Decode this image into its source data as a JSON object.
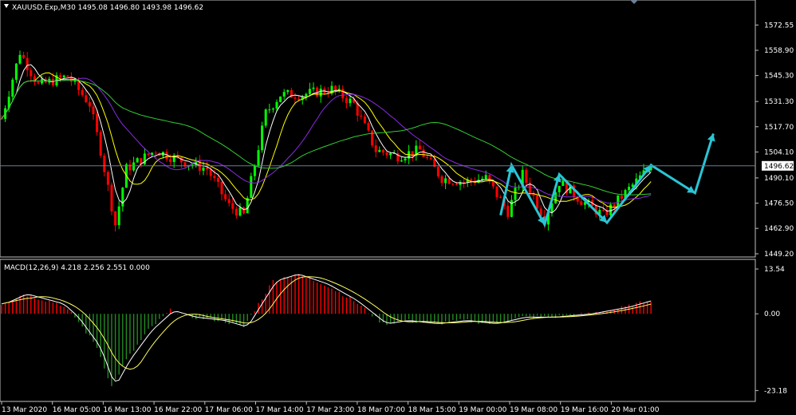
{
  "window": {
    "symbol_info": "XAUUSD.Exp,M30  1495.08 1496.80 1493.98 1496.62",
    "macd_info": "MACD(12,26,9) 4.218 2.256 2.551 0.000"
  },
  "colors": {
    "background": "#000000",
    "frame": "#c0c0c0",
    "bull": "#00ff00",
    "bear": "#ff0000",
    "ma_fast": "#ffffff",
    "ma_mid": "#ffff00",
    "ma_slow": "#8a2be2",
    "ma_long": "#32cd32",
    "annotation": "#29c5d6",
    "macd_up": "#ff0000",
    "macd_down": "#228b22",
    "signal": "#ffff66"
  },
  "chart_data": [
    {
      "type": "candlestick",
      "name": "price",
      "ylim": [
        1449.2,
        1580.0
      ],
      "price_ticks": [
        "1572.55",
        "1558.90",
        "1545.30",
        "1531.30",
        "1517.70",
        "1504.10",
        "1490.10",
        "1476.50",
        "1462.90",
        "1449.20"
      ],
      "current_price": "1496.62",
      "x_ticks": [
        "13 Mar 2020",
        "16 Mar 05:00",
        "16 Mar 13:00",
        "16 Mar 22:00",
        "17 Mar 06:00",
        "17 Mar 14:00",
        "17 Mar 23:00",
        "18 Mar 07:00",
        "18 Mar 15:00",
        "19 Mar 00:00",
        "19 Mar 08:00",
        "19 Mar 16:00",
        "20 Mar 01:00"
      ],
      "anchors": [
        {
          "i": 0,
          "p": 1522
        },
        {
          "i": 5,
          "p": 1558
        },
        {
          "i": 10,
          "p": 1540
        },
        {
          "i": 18,
          "p": 1545
        },
        {
          "i": 24,
          "p": 1530
        },
        {
          "i": 27,
          "p": 1505
        },
        {
          "i": 31,
          "p": 1465
        },
        {
          "i": 34,
          "p": 1495
        },
        {
          "i": 42,
          "p": 1505
        },
        {
          "i": 48,
          "p": 1500
        },
        {
          "i": 56,
          "p": 1495
        },
        {
          "i": 62,
          "p": 1475
        },
        {
          "i": 66,
          "p": 1470
        },
        {
          "i": 72,
          "p": 1525
        },
        {
          "i": 76,
          "p": 1535
        },
        {
          "i": 82,
          "p": 1535
        },
        {
          "i": 90,
          "p": 1538
        },
        {
          "i": 96,
          "p": 1530
        },
        {
          "i": 102,
          "p": 1505
        },
        {
          "i": 108,
          "p": 1502
        },
        {
          "i": 114,
          "p": 1505
        },
        {
          "i": 120,
          "p": 1490
        },
        {
          "i": 126,
          "p": 1488
        },
        {
          "i": 132,
          "p": 1490
        },
        {
          "i": 138,
          "p": 1472
        },
        {
          "i": 142,
          "p": 1492
        },
        {
          "i": 148,
          "p": 1468
        },
        {
          "i": 152,
          "p": 1488
        },
        {
          "i": 158,
          "p": 1478
        },
        {
          "i": 164,
          "p": 1470
        },
        {
          "i": 170,
          "p": 1482
        },
        {
          "i": 177,
          "p": 1496.62
        }
      ],
      "annotation_path": [
        {
          "i": 136,
          "p": 1470
        },
        {
          "i": 139,
          "p": 1497
        },
        {
          "i": 148,
          "p": 1465
        },
        {
          "i": 152,
          "p": 1492
        },
        {
          "i": 165,
          "p": 1466
        },
        {
          "i": 177,
          "p": 1497
        },
        {
          "i": 189,
          "p": 1482
        },
        {
          "i": 194,
          "p": 1514
        }
      ]
    },
    {
      "type": "bar",
      "name": "MACD",
      "ylim": [
        -25.5,
        15.0
      ],
      "ticks": [
        "13.54",
        "0.00",
        "-23.18"
      ],
      "anchors": [
        {
          "i": 0,
          "v": 3
        },
        {
          "i": 6,
          "v": 6
        },
        {
          "i": 16,
          "v": 3
        },
        {
          "i": 20,
          "v": -1
        },
        {
          "i": 26,
          "v": -10
        },
        {
          "i": 30,
          "v": -22
        },
        {
          "i": 34,
          "v": -14
        },
        {
          "i": 40,
          "v": -5
        },
        {
          "i": 46,
          "v": 1
        },
        {
          "i": 52,
          "v": -1
        },
        {
          "i": 60,
          "v": -2
        },
        {
          "i": 66,
          "v": -4
        },
        {
          "i": 74,
          "v": 10
        },
        {
          "i": 80,
          "v": 12
        },
        {
          "i": 88,
          "v": 9
        },
        {
          "i": 96,
          "v": 4
        },
        {
          "i": 104,
          "v": -3
        },
        {
          "i": 110,
          "v": -2
        },
        {
          "i": 118,
          "v": -3
        },
        {
          "i": 126,
          "v": -2
        },
        {
          "i": 134,
          "v": -3
        },
        {
          "i": 142,
          "v": -1
        },
        {
          "i": 150,
          "v": -1
        },
        {
          "i": 160,
          "v": 0
        },
        {
          "i": 170,
          "v": 2
        },
        {
          "i": 177,
          "v": 4.2
        }
      ]
    }
  ]
}
